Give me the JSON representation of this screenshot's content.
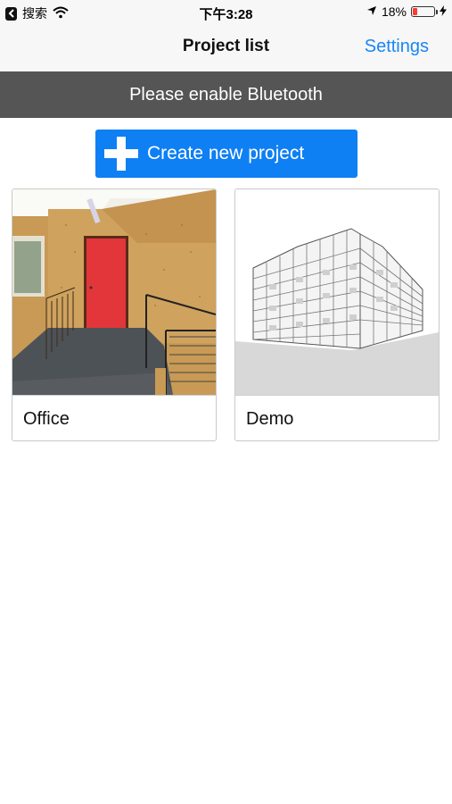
{
  "status_bar": {
    "carrier": "搜索",
    "time": "下午3:28",
    "battery": "18%",
    "battery_level": 0.18,
    "icons": [
      "back-icon",
      "wifi-icon",
      "location-arrow-icon",
      "battery-icon",
      "charging-bolt-icon"
    ]
  },
  "nav": {
    "title": "Project list",
    "settings_label": "Settings"
  },
  "banner": {
    "text": "Please enable Bluetooth"
  },
  "create_button": {
    "label": "Create new project",
    "icon": "plus-icon"
  },
  "projects": [
    {
      "name": "Office",
      "thumbnail": "office-photo"
    },
    {
      "name": "Demo",
      "thumbnail": "building-sketch"
    }
  ],
  "colors": {
    "accent": "#1a86f0",
    "button": "#0f7ff4",
    "banner": "#555555",
    "battery_low": "#ff3b30"
  }
}
